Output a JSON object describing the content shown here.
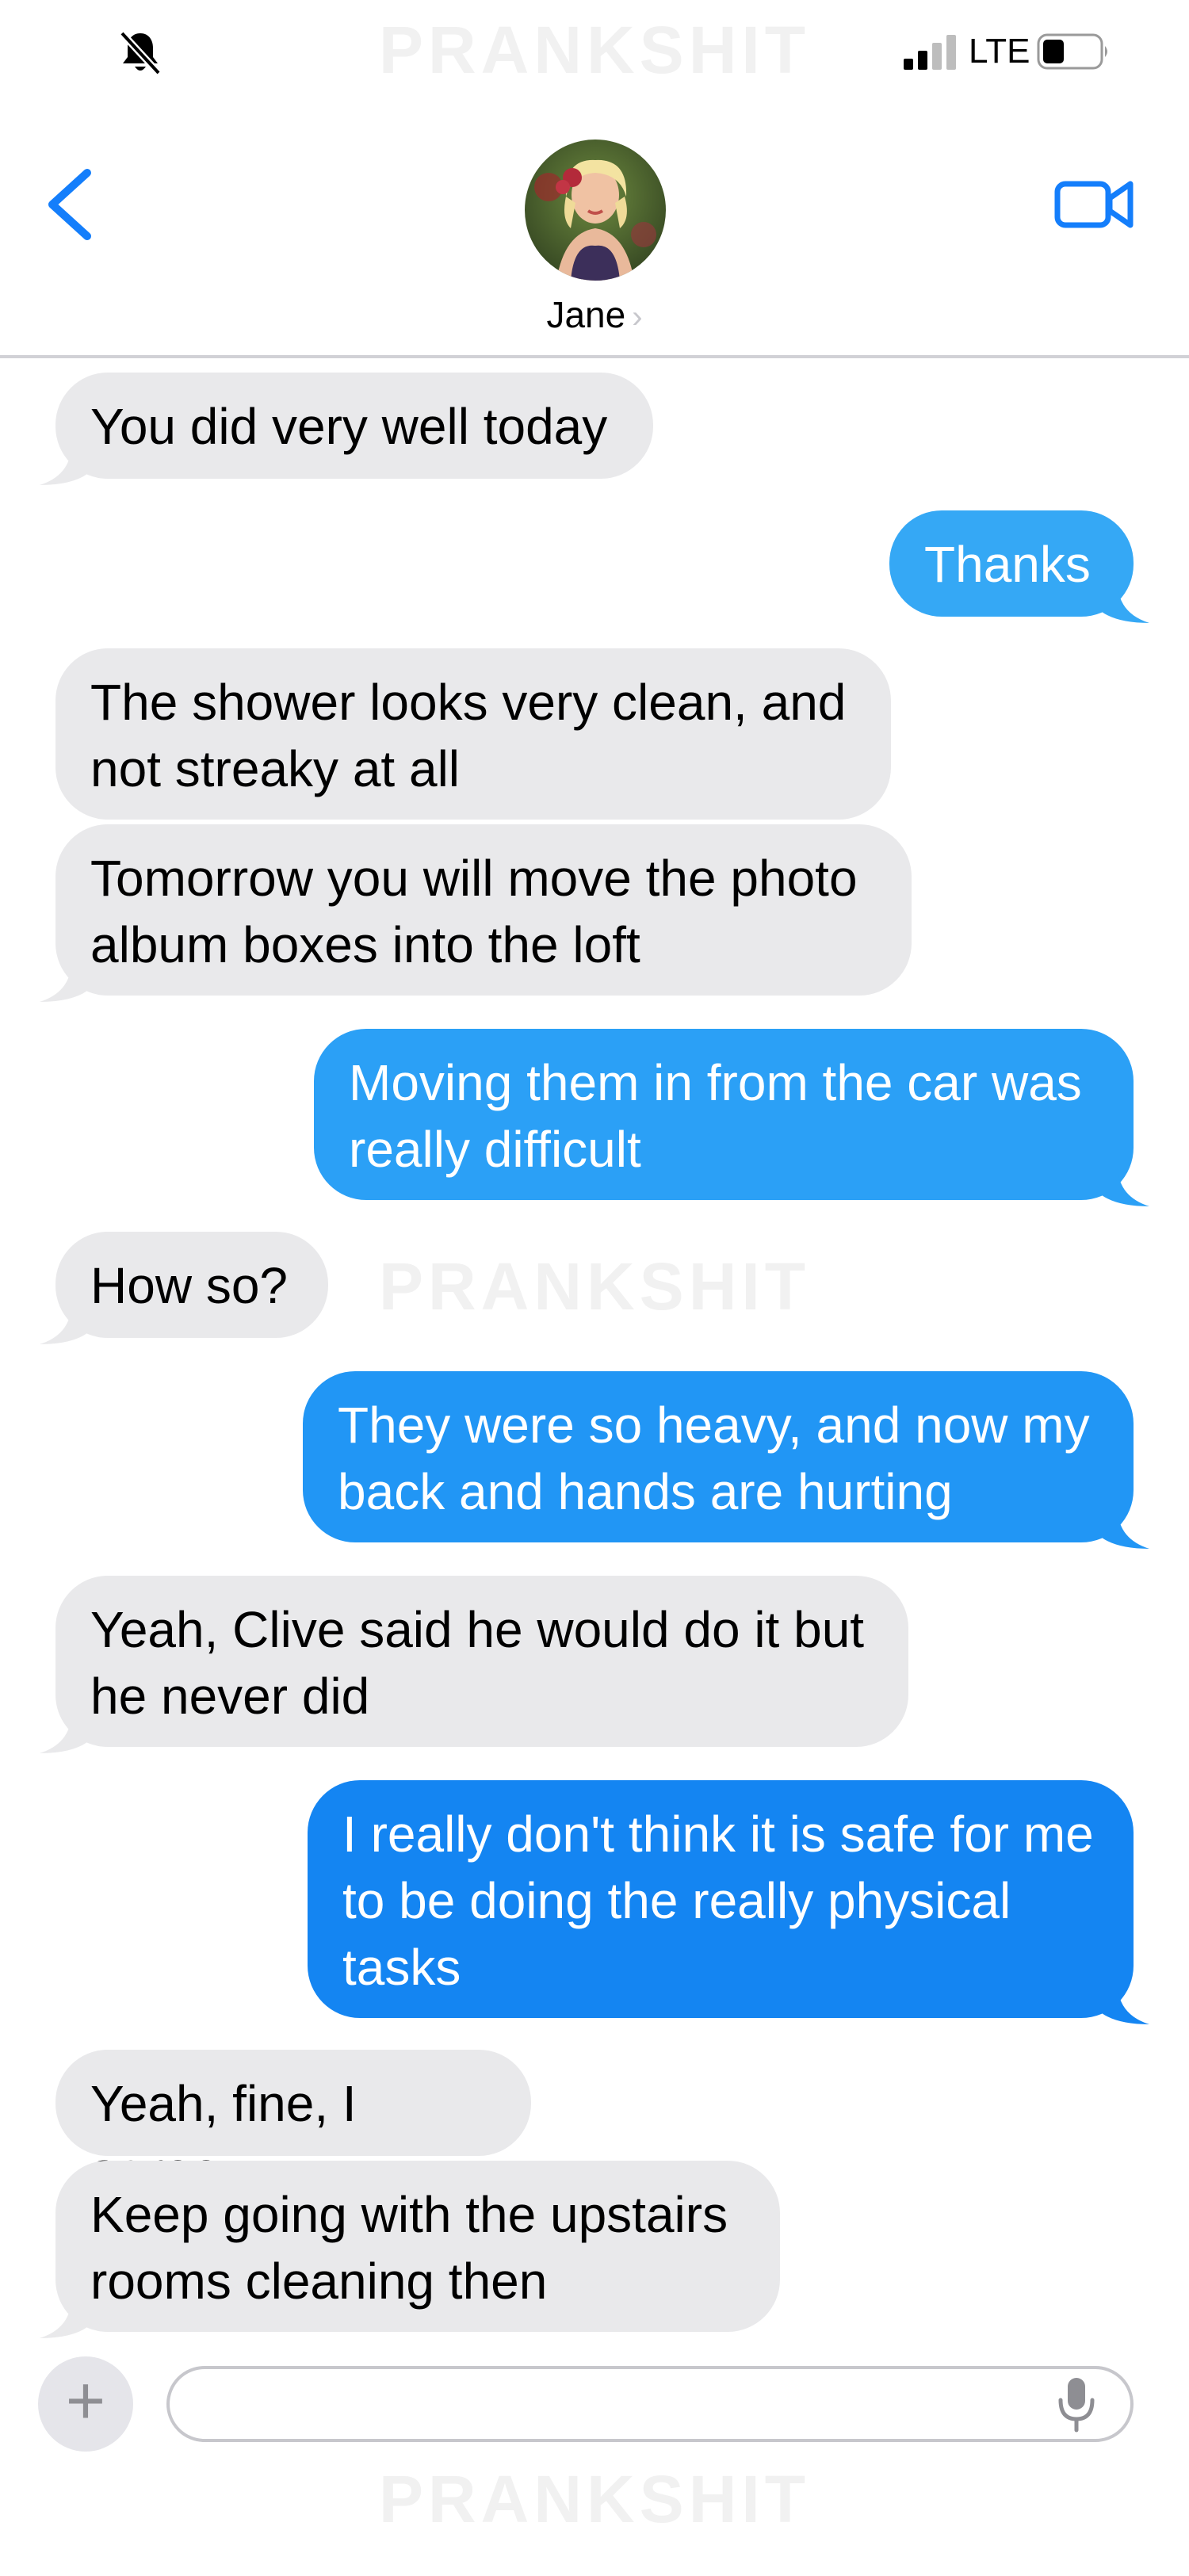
{
  "watermark": "PRANKSHIT",
  "status_bar": {
    "network": "LTE",
    "icons": [
      "bell-slash-icon",
      "signal-icon",
      "battery-icon"
    ]
  },
  "header": {
    "contact_name": "Jane",
    "chevron": "›",
    "icons": [
      "back-chevron-icon",
      "video-camera-icon"
    ]
  },
  "colors": {
    "accent": "#147efb",
    "incoming_bubble": "#e9e9eb",
    "outgoing_bubble_light": "#35a8f5",
    "outgoing_bubble": "#1e8ef3",
    "outgoing_bubble_dark": "#0f7ef0"
  },
  "messages": [
    {
      "from": "them",
      "text": "You did very well today"
    },
    {
      "from": "me",
      "text": "Thanks"
    },
    {
      "from": "them",
      "text": "The shower looks very clean, and not streaky at all"
    },
    {
      "from": "them",
      "text": "Tomorrow you will move the photo album boxes into the loft"
    },
    {
      "from": "me",
      "text": "Moving them in from the car was really difficult"
    },
    {
      "from": "them",
      "text": "How so?"
    },
    {
      "from": "me",
      "text": "They were so heavy, and now my back and hands are hurting"
    },
    {
      "from": "them",
      "text": "Yeah, Clive said he would do it but he never did"
    },
    {
      "from": "me",
      "text": "I really don't think it is safe for me to be doing the really physical tasks"
    },
    {
      "from": "them",
      "text": "Yeah, fine, I agree"
    },
    {
      "from": "them",
      "text": "Keep going with the upstairs rooms cleaning then"
    }
  ],
  "composer": {
    "plus_label": "+",
    "input_value": "",
    "icons": [
      "plus-icon",
      "microphone-icon"
    ]
  }
}
